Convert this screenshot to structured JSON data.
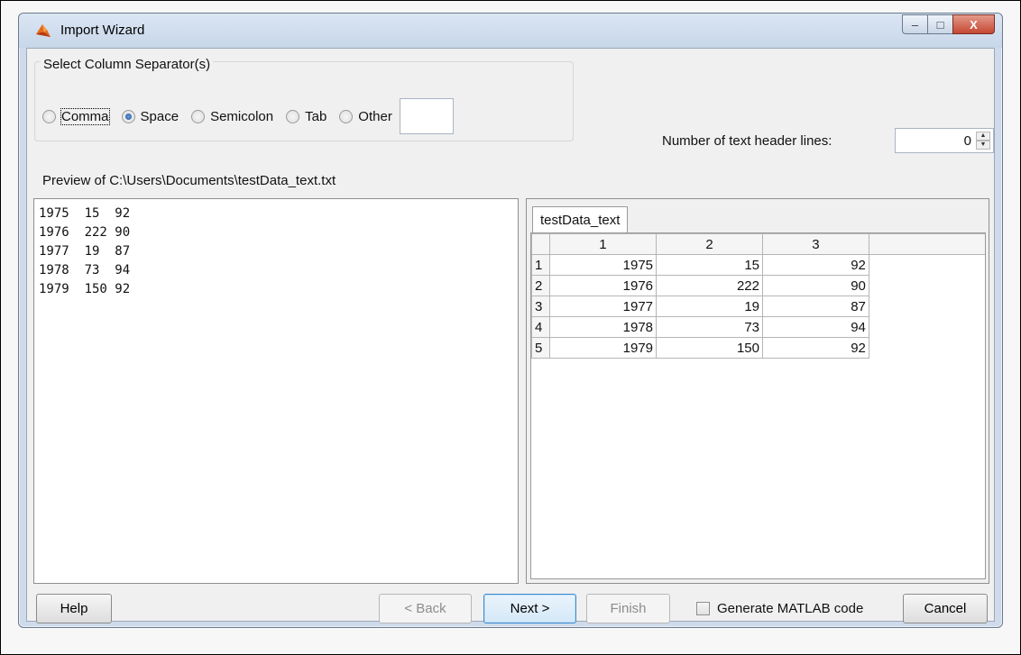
{
  "window": {
    "title": "Import Wizard",
    "icon": "matlab-logo-icon",
    "controls": {
      "minimize": "–",
      "maximize": "□",
      "close": "X"
    }
  },
  "separators": {
    "legend": "Select Column Separator(s)",
    "options": [
      {
        "label": "Comma",
        "checked": false,
        "focused": true
      },
      {
        "label": "Space",
        "checked": true,
        "focused": false
      },
      {
        "label": "Semicolon",
        "checked": false,
        "focused": false
      },
      {
        "label": "Tab",
        "checked": false,
        "focused": false
      },
      {
        "label": "Other",
        "checked": false,
        "focused": false
      }
    ],
    "other_value": ""
  },
  "header_lines": {
    "label": "Number of text header lines:",
    "value": "0"
  },
  "preview": {
    "label": "Preview of C:\\Users\\Documents\\testData_text.txt",
    "lines": [
      "1975  15  92",
      "1976  222 90",
      "1977  19  87",
      "1978  73  94",
      "1979  150 92"
    ]
  },
  "data_table": {
    "tab_label": "testData_text",
    "columns": [
      "1",
      "2",
      "3"
    ],
    "rows": [
      {
        "index": "1",
        "cells": [
          "1975",
          "15",
          "92"
        ]
      },
      {
        "index": "2",
        "cells": [
          "1976",
          "222",
          "90"
        ]
      },
      {
        "index": "3",
        "cells": [
          "1977",
          "19",
          "87"
        ]
      },
      {
        "index": "4",
        "cells": [
          "1978",
          "73",
          "94"
        ]
      },
      {
        "index": "5",
        "cells": [
          "1979",
          "150",
          "92"
        ]
      }
    ]
  },
  "buttons": {
    "help": "Help",
    "back": "< Back",
    "next": "Next >",
    "finish": "Finish",
    "generate_code": "Generate MATLAB code",
    "cancel": "Cancel"
  },
  "colors": {
    "title_bar": "#cfdbea",
    "close_button": "#c54733",
    "selected_radio": "#1e4f8f"
  }
}
